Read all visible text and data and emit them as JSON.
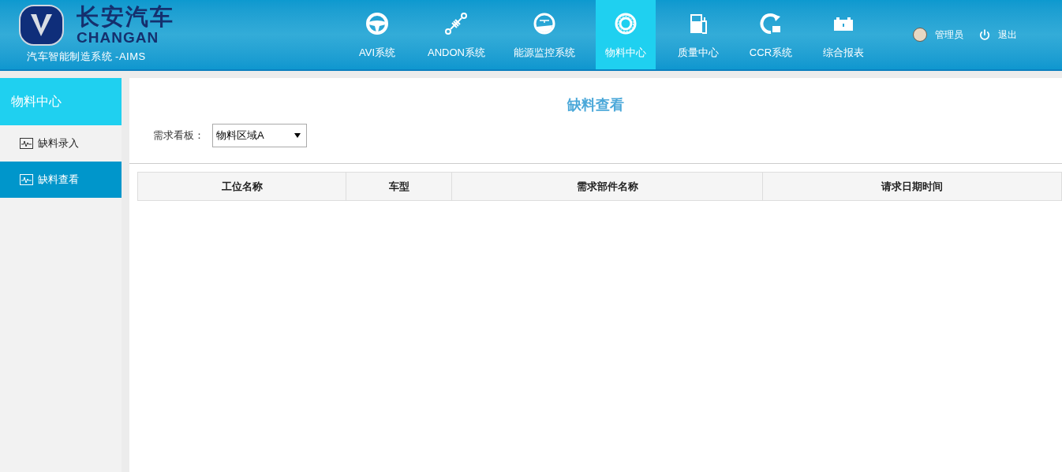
{
  "brand": {
    "name_cn": "长安汽车",
    "name_en": "CHANGAN",
    "subtitle": "汽车智能制造系统 -AIMS"
  },
  "nav": [
    {
      "label": "AVI系统",
      "selected": false
    },
    {
      "label": "ANDON系统",
      "selected": false
    },
    {
      "label": "能源监控系统",
      "selected": false
    },
    {
      "label": "物料中心",
      "selected": true
    },
    {
      "label": "质量中心",
      "selected": false
    },
    {
      "label": "CCR系统",
      "selected": false
    },
    {
      "label": "综合报表",
      "selected": false
    }
  ],
  "user": {
    "name": "管理员",
    "logout": "退出"
  },
  "sidebar": {
    "title": "物料中心",
    "items": [
      {
        "label": "缺料录入",
        "selected": false
      },
      {
        "label": "缺料查看",
        "selected": true
      }
    ]
  },
  "page": {
    "title": "缺料查看",
    "filter_label": "需求看板：",
    "filter_value": "物料区域A"
  },
  "table": {
    "columns": [
      "工位名称",
      "车型",
      "需求部件名称",
      "请求日期时间"
    ]
  }
}
